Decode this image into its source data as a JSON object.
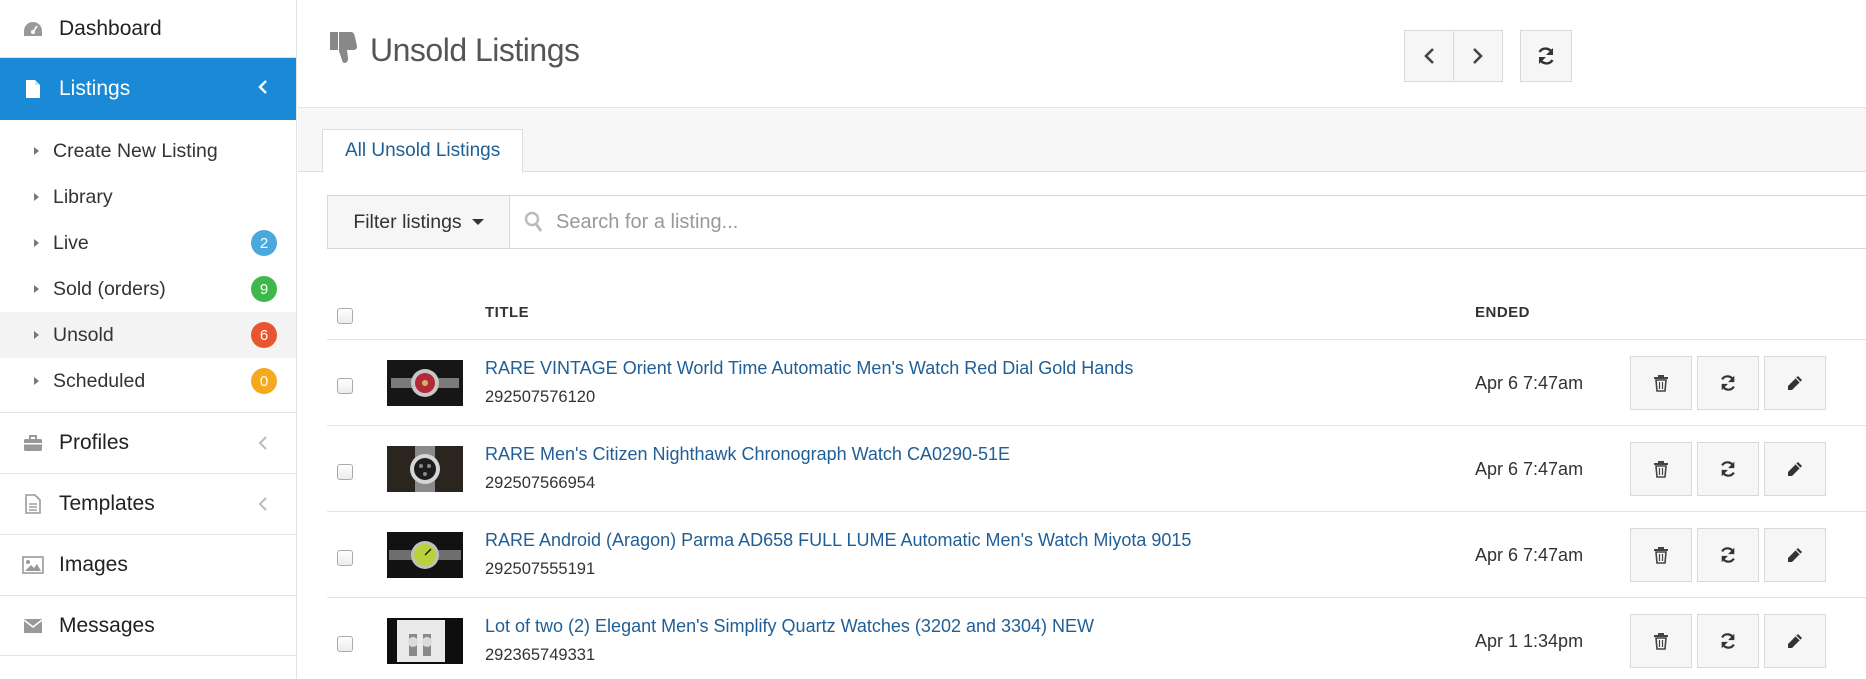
{
  "sidebar": {
    "dashboard": "Dashboard",
    "listings": "Listings",
    "sub_items": [
      {
        "label": "Create New Listing"
      },
      {
        "label": "Library"
      },
      {
        "label": "Live",
        "badge": "2",
        "badge_color": "#4aa8dd"
      },
      {
        "label": "Sold (orders)",
        "badge": "9",
        "badge_color": "#3fb74a"
      },
      {
        "label": "Unsold",
        "badge": "6",
        "badge_color": "#e8552f"
      },
      {
        "label": "Scheduled",
        "badge": "0",
        "badge_color": "#f4aa1f"
      }
    ],
    "profiles": "Profiles",
    "templates": "Templates",
    "images": "Images",
    "messages": "Messages"
  },
  "header": {
    "title": "Unsold Listings",
    "icon": "thumbs-down-icon"
  },
  "tabs": [
    {
      "label": "All Unsold Listings"
    }
  ],
  "filter": {
    "label": "Filter listings",
    "search_placeholder": "Search for a listing..."
  },
  "table": {
    "columns": {
      "title": "TITLE",
      "ended": "ENDED"
    },
    "rows": [
      {
        "title": "RARE VINTAGE Orient World Time Automatic Men's Watch Red Dial Gold Hands",
        "id": "292507576120",
        "ended": "Apr 6 7:47am"
      },
      {
        "title": "RARE Men's Citizen Nighthawk Chronograph Watch CA0290-51E",
        "id": "292507566954",
        "ended": "Apr 6 7:47am"
      },
      {
        "title": "RARE Android (Aragon) Parma AD658 FULL LUME Automatic Men's Watch Miyota 9015",
        "id": "292507555191",
        "ended": "Apr 6 7:47am"
      },
      {
        "title": "Lot of two (2) Elegant Men's Simplify Quartz Watches (3202 and 3304) NEW",
        "id": "292365749331",
        "ended": "Apr 1 1:34pm"
      }
    ]
  },
  "colors": {
    "accent": "#1a8ad6",
    "link": "#1f5e96"
  }
}
